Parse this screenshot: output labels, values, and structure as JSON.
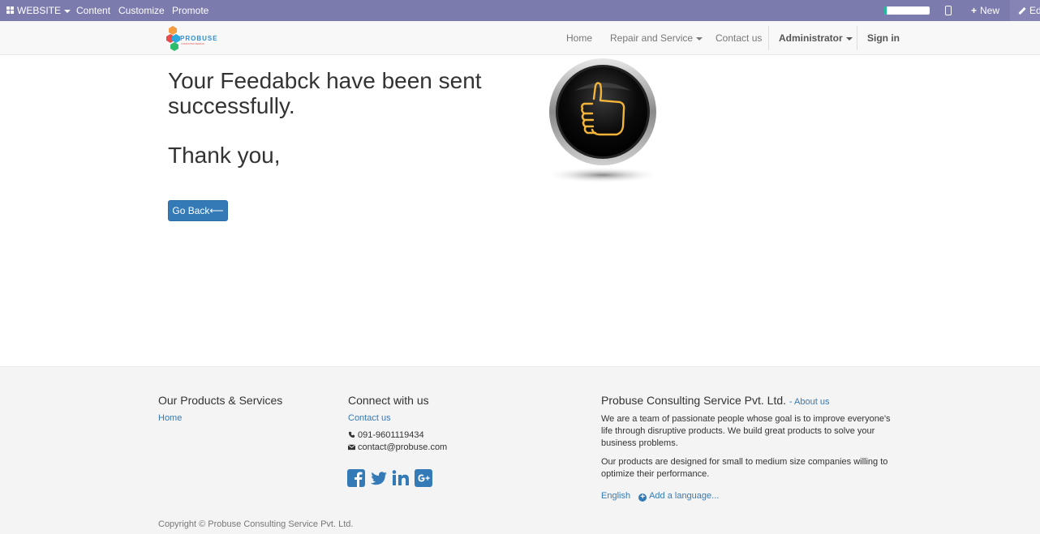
{
  "admin_bar": {
    "website_label": "WEBSITE",
    "menu": [
      "Content",
      "Customize",
      "Promote"
    ],
    "progress": 0.05,
    "new_label": "New",
    "edit_label": "Ed"
  },
  "navbar": {
    "logo_text": "PROBUSE",
    "logo_tagline": "CONSULTING SERVICE",
    "links": [
      "Home",
      "Repair and Service",
      "Contact us"
    ],
    "user": "Administrator",
    "sign_in": "Sign in"
  },
  "main": {
    "headline": "Your Feedabck have been sent successfully.",
    "thanks": "Thank you,",
    "go_back": "Go Back⟵"
  },
  "footer": {
    "products_title": "Our Products & Services",
    "products_links": [
      "Home"
    ],
    "connect_title": "Connect with us",
    "connect_link": "Contact us",
    "phone": "091-9601119434",
    "email": "contact@probuse.com",
    "company_title": "Probuse Consulting Service Pvt. Ltd.",
    "about_link": "- About us",
    "about_p1": "We are a team of passionate people whose goal is to improve everyone's life through disruptive products. We build great products to solve your business problems.",
    "about_p2": "Our products are designed for small to medium size companies willing to optimize their performance.",
    "language": "English",
    "add_language": "Add a language...",
    "copyright": "Copyright © Probuse Consulting Service Pvt. Ltd."
  },
  "colors": {
    "admin_bar": "#7c7bad",
    "link": "#337ab7",
    "social": "#337ab7"
  }
}
